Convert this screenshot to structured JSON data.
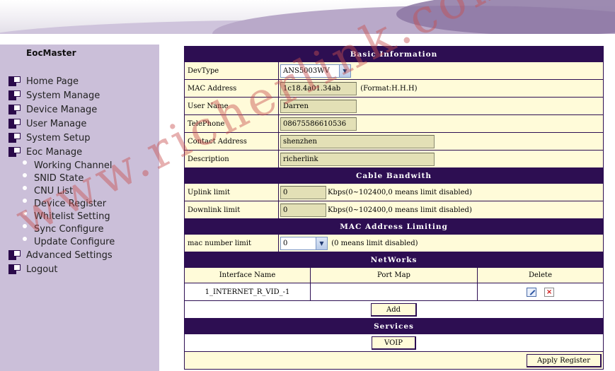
{
  "sidebar": {
    "title": "EocMaster",
    "menu": [
      {
        "label": "Home Page"
      },
      {
        "label": "System Manage"
      },
      {
        "label": "Device Manage"
      },
      {
        "label": "User Manage"
      },
      {
        "label": "System Setup"
      },
      {
        "label": "Eoc Manage"
      }
    ],
    "submenu": [
      {
        "label": "Working Channel"
      },
      {
        "label": "SNID State"
      },
      {
        "label": "CNU List"
      },
      {
        "label": "Device Register"
      },
      {
        "label": "Whitelist Setting"
      },
      {
        "label": "Sync Configure"
      },
      {
        "label": "Update Configure"
      }
    ],
    "menu_after": [
      {
        "label": "Advanced Settings"
      },
      {
        "label": "Logout"
      }
    ]
  },
  "basic": {
    "title": "Basic Information",
    "devtype_label": "DevType",
    "devtype_value": "ANS5003WV",
    "mac_label": "MAC Address",
    "mac_value": "1c18.4a01.34ab",
    "mac_hint": "(Format:H.H.H)",
    "username_label": "User Name",
    "username_value": "Darren",
    "telephone_label": "TelePhone",
    "telephone_value": "08675586610536",
    "contact_label": "Contact Address",
    "contact_value": "shenzhen",
    "description_label": "Description",
    "description_value": "richerlink"
  },
  "bandwidth": {
    "title": "Cable Bandwith",
    "uplink_label": "Uplink limit",
    "uplink_value": "0",
    "uplink_hint": "Kbps(0~102400,0 means limit disabled)",
    "downlink_label": "Downlink limit",
    "downlink_value": "0",
    "downlink_hint": "Kbps(0~102400,0 means limit disabled)"
  },
  "mac_limit": {
    "title": "MAC Address Limiting",
    "label": "mac number limit",
    "value": "0",
    "hint": "(0 means limit disabled)"
  },
  "networks": {
    "title": "NetWorks",
    "columns": [
      "Interface Name",
      "Port Map",
      "Delete"
    ],
    "rows": [
      {
        "interface": "1_INTERNET_R_VID_-1",
        "port_map": ""
      }
    ],
    "add_label": "Add"
  },
  "services": {
    "title": "Services",
    "voip_label": "VOIP"
  },
  "apply_label": "Apply Register",
  "watermark": "www.richerlink.com"
}
